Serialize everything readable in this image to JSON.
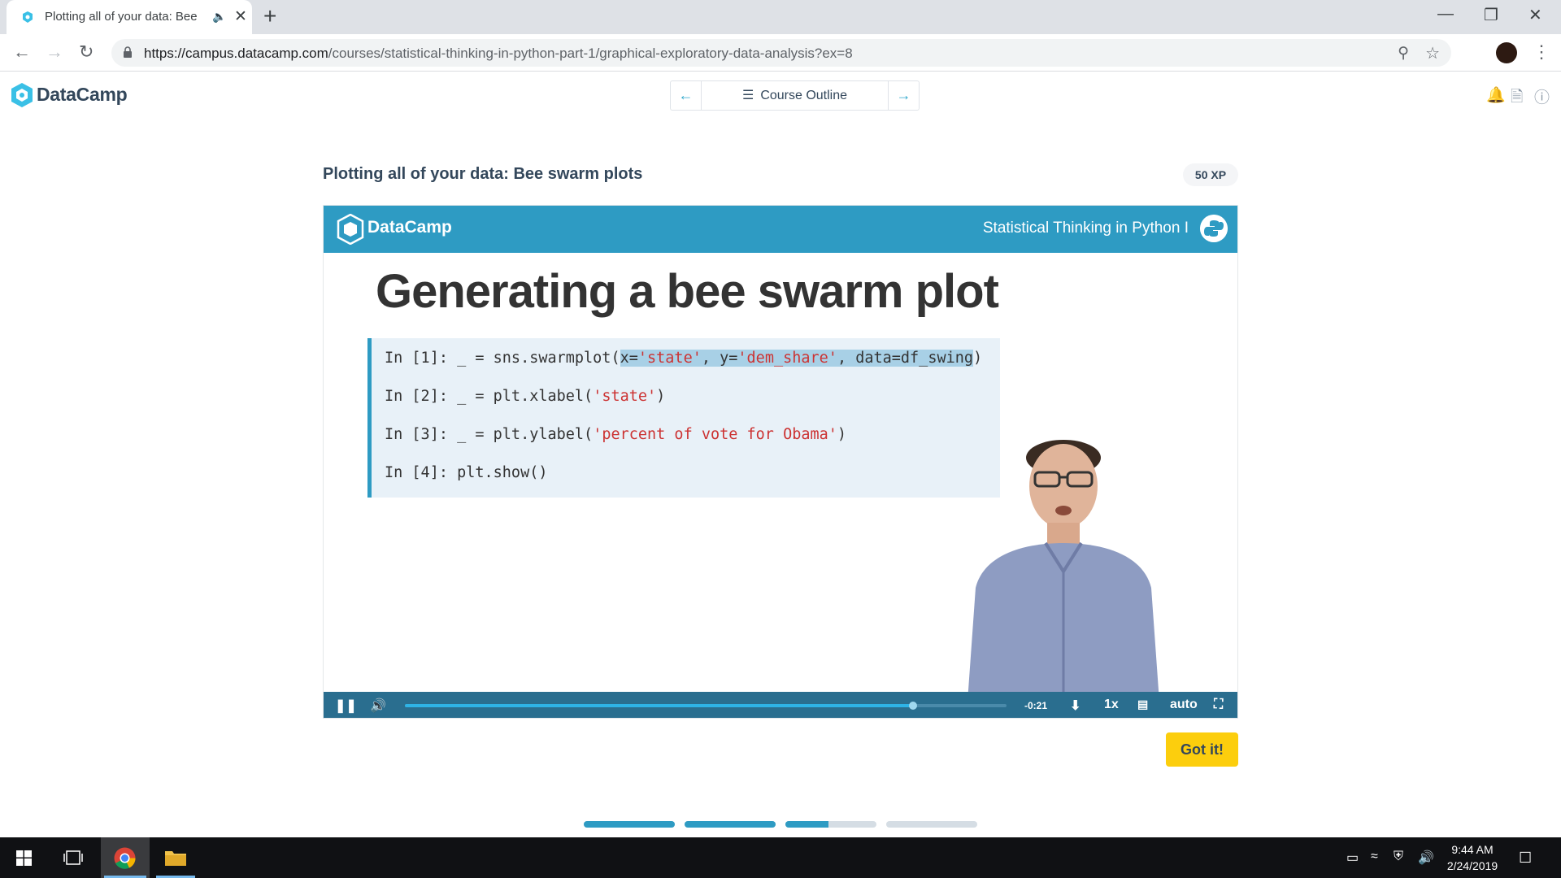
{
  "browser": {
    "tab_title": "Plotting all of your data: Bee",
    "url_host": "https://campus.datacamp.com",
    "url_path": "/courses/statistical-thinking-in-python-part-1/graphical-exploratory-data-analysis?ex=8"
  },
  "header": {
    "brand": "DataCamp",
    "course_outline_label": "Course Outline"
  },
  "lesson": {
    "title": "Plotting all of your data: Bee swarm plots",
    "xp": "50 XP"
  },
  "slide": {
    "brand": "DataCamp",
    "course": "Statistical Thinking in Python I",
    "heading": "Generating a bee swarm plot",
    "code": [
      {
        "prefix": "In [1]: _ = sns.swarmplot(",
        "hl_a": "x=",
        "hl_s1": "'state'",
        "hl_b": ", y=",
        "hl_s2": "'dem_share'",
        "hl_c": ", data=df_swing",
        "suffix": ")"
      },
      {
        "prefix": "In [2]: _ = plt.xlabel(",
        "str": "'state'",
        "suffix": ")"
      },
      {
        "prefix": "In [3]: _ = plt.ylabel(",
        "str": "'percent of vote for Obama'",
        "suffix": ")"
      },
      {
        "prefix": "In [4]: plt.show()"
      }
    ]
  },
  "player": {
    "progress": 0.845,
    "time_left": "-0:21",
    "speed": "1x",
    "quality": "auto"
  },
  "actions": {
    "got_it": "Got it!"
  },
  "steps": [
    {
      "progress": 1.0
    },
    {
      "progress": 1.0
    },
    {
      "progress": 0.47
    },
    {
      "progress": 0.0
    }
  ],
  "taskbar": {
    "time": "9:44 AM",
    "date": "2/24/2019"
  },
  "colors": {
    "accent": "#2e9bc3",
    "button": "#fcce0d",
    "code_bg": "#e8f1f8",
    "string": "#cc3333",
    "highlight": "#a8d0e6"
  }
}
